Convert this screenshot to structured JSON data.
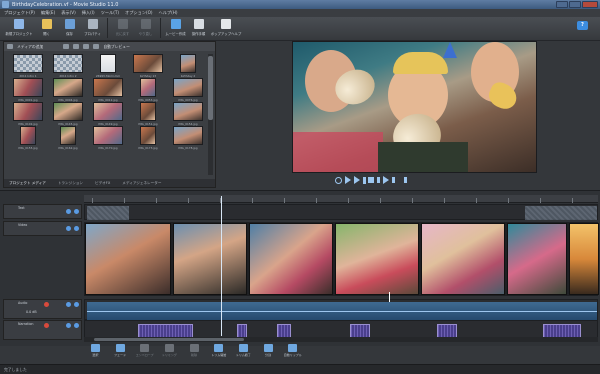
{
  "window": {
    "title": "BirthdayCelebration.vf - Movie Studio 11.0"
  },
  "menu": [
    "プロジェクト(P)",
    "編集(E)",
    "表示(V)",
    "挿入(I)",
    "ツール(T)",
    "オプション(O)",
    "ヘルプ(H)"
  ],
  "ribbon": {
    "buttons": [
      {
        "label": "新規プロジェクト",
        "icon": "new-project-icon",
        "color": "#8fb7e8",
        "dim": false
      },
      {
        "label": "開く",
        "icon": "open-folder-icon",
        "color": "#e8c15a",
        "dim": false
      },
      {
        "label": "保存",
        "icon": "save-icon",
        "color": "#6c9fd6",
        "dim": false
      },
      {
        "label": "プロパティ",
        "icon": "properties-icon",
        "color": "#aab4c0",
        "dim": false
      },
      {
        "label": "元に戻す",
        "icon": "undo-icon",
        "color": "#9aa3ad",
        "dim": true
      },
      {
        "label": "やり直し",
        "icon": "redo-icon",
        "color": "#9aa3ad",
        "dim": true
      },
      {
        "label": "ムービー作成",
        "icon": "make-movie-icon",
        "color": "#5aa3e6",
        "dim": false
      },
      {
        "label": "操作手順",
        "icon": "show-me-how-icon",
        "color": "#d8dde3",
        "dim": false
      },
      {
        "label": "ポップアップヘルプ",
        "icon": "popup-help-icon",
        "color": "#e4e7ea",
        "dim": false
      }
    ],
    "help_label": "?"
  },
  "media": {
    "toolbar_left": "メディアの追加",
    "toolbar_right": "自動プレビュー",
    "items": [
      {
        "name": "2011 Intro 1",
        "kind": "checker",
        "small": false
      },
      {
        "name": "2011 Intro 2",
        "kind": "checker",
        "small": false
      },
      {
        "name": "26993-fdomi.mm",
        "kind": "music",
        "small": true
      },
      {
        "name": "birthday 13",
        "kind": "photo-a",
        "small": false
      },
      {
        "name": "birthday 2",
        "kind": "photo-b",
        "small": true
      },
      {
        "name": "IMG_0001.jpg",
        "kind": "photo-c",
        "small": false
      },
      {
        "name": "IMG_0004.jpg",
        "kind": "photo-d",
        "small": false
      },
      {
        "name": "IMG_0012.jpg",
        "kind": "photo-a",
        "small": false
      },
      {
        "name": "IMG_0053.jpg",
        "kind": "photo-e",
        "small": true
      },
      {
        "name": "IMG_0076.jpg",
        "kind": "photo-b",
        "small": false
      },
      {
        "name": "IMG_0102.jpg",
        "kind": "photo-c",
        "small": false
      },
      {
        "name": "IMG_0145.jpg",
        "kind": "photo-d",
        "small": false
      },
      {
        "name": "IMG_0149.jpg",
        "kind": "photo-e",
        "small": false
      },
      {
        "name": "IMG_0151.jpg",
        "kind": "photo-a",
        "small": true
      },
      {
        "name": "IMG_0154.jpg",
        "kind": "photo-b",
        "small": false
      },
      {
        "name": "IMG_0155.jpg",
        "kind": "photo-c",
        "small": true
      },
      {
        "name": "IMG_0162.jpg",
        "kind": "photo-d",
        "small": true
      },
      {
        "name": "IMG_0170.jpg",
        "kind": "photo-e",
        "small": false
      },
      {
        "name": "IMG_0173.jpg",
        "kind": "photo-a",
        "small": true
      },
      {
        "name": "IMG_0178.jpg",
        "kind": "photo-b",
        "small": false
      }
    ],
    "tabs": [
      "プロジェクト メディア",
      "トランジション",
      "ビデオFX",
      "メディアジェネレーター"
    ]
  },
  "timeline": {
    "tracks": [
      {
        "label": "Text"
      },
      {
        "label": "Video"
      },
      {
        "label": "Audio"
      },
      {
        "label": "Narration"
      }
    ],
    "audio_gain_label": "0.0 dB"
  },
  "edit_toolbar": [
    {
      "label": "選択",
      "icon": "select-icon",
      "dim": false
    },
    {
      "label": "フェード",
      "icon": "fade-icon",
      "dim": false
    },
    {
      "label": "エンベロープ",
      "icon": "envelope-icon",
      "dim": true
    },
    {
      "label": "トリミング",
      "icon": "crop-icon",
      "dim": true
    },
    {
      "label": "削除",
      "icon": "delete-icon",
      "dim": true
    },
    {
      "label": "トリム開始",
      "icon": "trim-start-icon",
      "dim": false
    },
    {
      "label": "トリム終了",
      "icon": "trim-end-icon",
      "dim": false
    },
    {
      "label": "分割",
      "icon": "split-icon",
      "dim": false
    },
    {
      "label": "自動リップル",
      "icon": "auto-ripple-icon",
      "dim": false
    }
  ],
  "status": {
    "text": "完了しました"
  }
}
